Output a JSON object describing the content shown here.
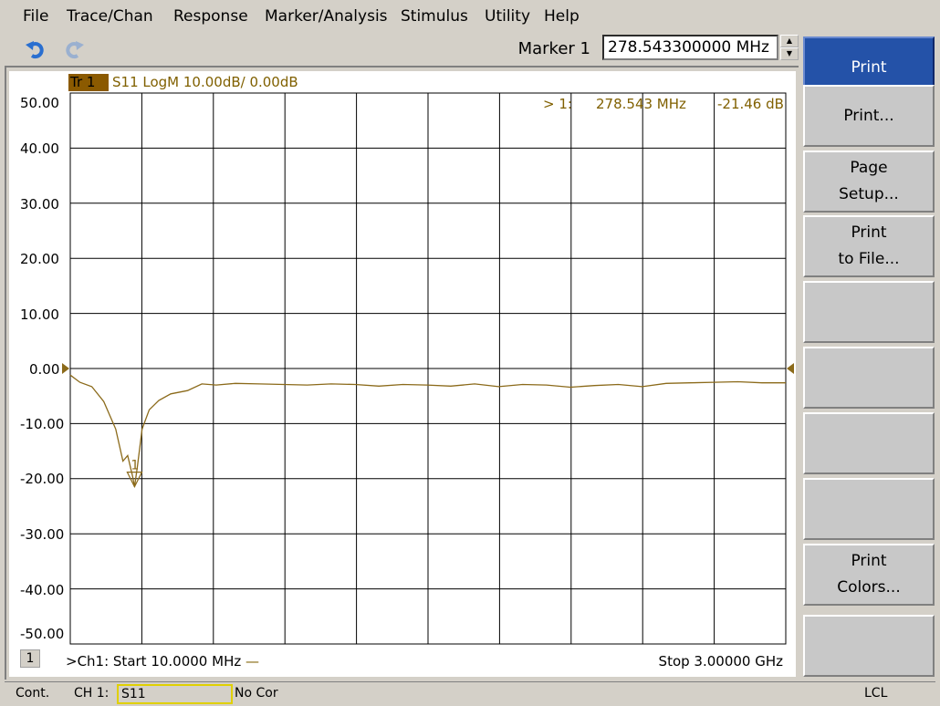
{
  "menu": [
    "File",
    "Trace/Chan",
    "Response",
    "Marker/Analysis",
    "Stimulus",
    "Utility",
    "Help"
  ],
  "toolbar": {
    "undo_icon": "undo-arrow-icon",
    "redo_icon": "redo-arrow-icon",
    "marker_label": "Marker 1",
    "marker_value": "278.543300000 MHz"
  },
  "trace": {
    "badge": "Tr 1",
    "info": "S11 LogM 10.00dB/  0.00dB",
    "marker_readout": {
      "marker": "> 1:",
      "freq": "278.543 MHz",
      "value": "-21.46 dB"
    },
    "marker_tag": "1",
    "color": "#8b6a1a"
  },
  "chart_data": {
    "type": "line",
    "y_tick_labels": [
      "50.00",
      "40.00",
      "30.00",
      "20.00",
      "10.00",
      "0.00",
      "-10.00",
      "-20.00",
      "-30.00",
      "-40.00",
      "-50.00"
    ],
    "ylim": [
      -50,
      50
    ],
    "xlim_mhz": [
      10,
      3000
    ],
    "grid": true,
    "reference_level": 0,
    "series": [
      {
        "x_mhz": [
          10,
          50,
          100,
          150,
          200,
          230,
          250,
          270,
          278.5,
          290,
          310,
          340,
          380,
          430,
          500,
          560,
          620,
          700,
          800,
          900,
          1000,
          1100,
          1200,
          1300,
          1400,
          1500,
          1600,
          1700,
          1800,
          1900,
          2000,
          2100,
          2200,
          2300,
          2400,
          2500,
          2600,
          2700,
          2800,
          2900,
          3000
        ],
        "y_db": [
          -1.2,
          -2.5,
          -3.3,
          -6.0,
          -11.0,
          -16.8,
          -15.8,
          -19.5,
          -21.46,
          -18.0,
          -11.0,
          -7.5,
          -5.8,
          -4.6,
          -4.0,
          -2.8,
          -3.0,
          -2.7,
          -2.8,
          -2.9,
          -3.0,
          -2.8,
          -2.9,
          -3.2,
          -2.9,
          -3.0,
          -3.2,
          -2.8,
          -3.3,
          -2.9,
          -3.0,
          -3.4,
          -3.1,
          -2.9,
          -3.3,
          -2.7,
          -2.6,
          -2.5,
          -2.4,
          -2.6,
          -2.6
        ]
      }
    ],
    "marker": {
      "x_mhz": 278.543,
      "y_db": -21.46,
      "label": "1"
    }
  },
  "footer": {
    "channel_badge": "1",
    "start": ">Ch1:   Start  10.0000 MHz",
    "stop": "Stop  3.00000 GHz"
  },
  "softkeys": [
    {
      "lines": [
        "Print"
      ],
      "active": true
    },
    {
      "lines": [
        "Print..."
      ],
      "active": false
    },
    {
      "lines": [
        "Page",
        "Setup..."
      ],
      "active": false
    },
    {
      "lines": [
        "Print",
        "to File..."
      ],
      "active": false
    },
    {
      "lines": [],
      "active": false
    },
    {
      "lines": [],
      "active": false
    },
    {
      "lines": [],
      "active": false
    },
    {
      "lines": [],
      "active": false
    },
    {
      "lines": [
        "Print",
        "Colors..."
      ],
      "active": false
    },
    {
      "lines": [],
      "active": false
    }
  ],
  "status": {
    "mode": "Cont.",
    "channel": "CH 1:",
    "measurement": "S11",
    "correction": "No Cor",
    "remote": "LCL"
  }
}
